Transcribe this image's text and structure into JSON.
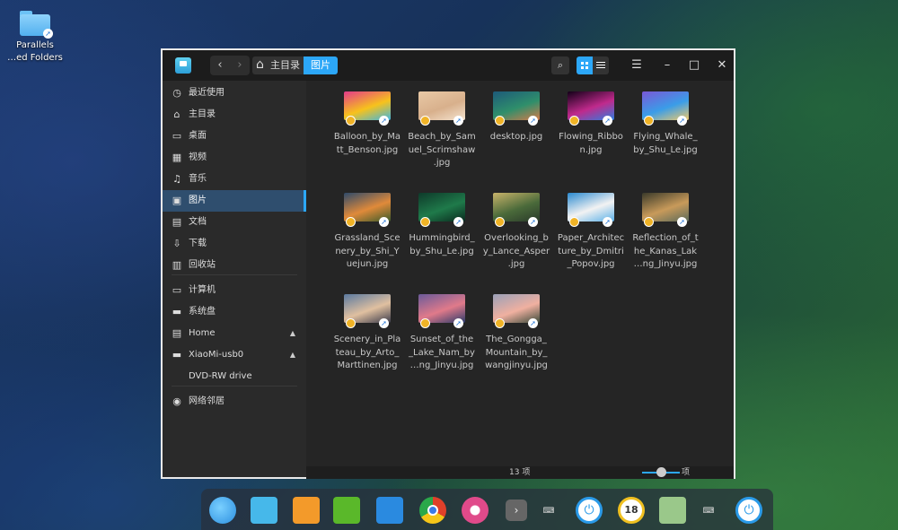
{
  "desktop": {
    "icon_label_line1": "Parallels",
    "icon_label_line2": "…ed Folders"
  },
  "window": {
    "breadcrumb": {
      "home": "主目录",
      "current": "图片"
    },
    "status": {
      "count": "13 项",
      "zoom_label": "项"
    }
  },
  "sidebar": {
    "items": [
      {
        "label": "最近使用",
        "icon": "clock-icon",
        "glyph": "◷"
      },
      {
        "label": "主目录",
        "icon": "home-icon",
        "glyph": "⌂"
      },
      {
        "label": "桌面",
        "icon": "desktop-icon",
        "glyph": "▭"
      },
      {
        "label": "视频",
        "icon": "video-icon",
        "glyph": "▦"
      },
      {
        "label": "音乐",
        "icon": "music-icon",
        "glyph": "♫"
      },
      {
        "label": "图片",
        "icon": "picture-icon",
        "glyph": "▣"
      },
      {
        "label": "文档",
        "icon": "document-icon",
        "glyph": "▤"
      },
      {
        "label": "下载",
        "icon": "download-icon",
        "glyph": "⇩"
      },
      {
        "label": "回收站",
        "icon": "trash-icon",
        "glyph": "▥"
      },
      {
        "label": "计算机",
        "icon": "computer-icon",
        "glyph": "▭"
      },
      {
        "label": "系统盘",
        "icon": "disk-icon",
        "glyph": "▬"
      },
      {
        "label": "Home",
        "icon": "drive-icon",
        "glyph": "▤"
      },
      {
        "label": "XiaoMi-usb0",
        "icon": "usb-icon",
        "glyph": "▬"
      },
      {
        "label": "DVD-RW drive",
        "icon": "",
        "glyph": ""
      },
      {
        "label": "网络邻居",
        "icon": "network-icon",
        "glyph": "◉"
      }
    ]
  },
  "files": [
    {
      "name": "Balloon_by_Matt_Benson.jpg",
      "colors": [
        "#e23a8a",
        "#f7c21c",
        "#3db6e3"
      ]
    },
    {
      "name": "Beach_by_Samuel_Scrimshaw.jpg",
      "colors": [
        "#e9c9a6",
        "#d8b08c",
        "#f4e3cf"
      ]
    },
    {
      "name": "desktop.jpg",
      "colors": [
        "#1d5a7a",
        "#2f8f6b",
        "#d47a4a"
      ]
    },
    {
      "name": "Flowing_Ribbon.jpg",
      "colors": [
        "#120018",
        "#c02a8c",
        "#2d7ee0"
      ]
    },
    {
      "name": "Flying_Whale_by_Shu_Le.jpg",
      "colors": [
        "#7a58d6",
        "#3a9de8",
        "#f0c96a"
      ]
    },
    {
      "name": "Grassland_Scenery_by_Shi_Yuejun.jpg",
      "colors": [
        "#2e4a6a",
        "#e08a3a",
        "#3a5a2a"
      ]
    },
    {
      "name": "Hummingbird_by_Shu_Le.jpg",
      "colors": [
        "#0e3a2a",
        "#1f7a4a",
        "#0a2a1e"
      ]
    },
    {
      "name": "Overlooking_by_Lance_Asper.jpg",
      "colors": [
        "#c8b36a",
        "#4a6a3a",
        "#2a3a2a"
      ]
    },
    {
      "name": "Paper_Architecture_by_Dmitri_Popov.jpg",
      "colors": [
        "#2a8ad0",
        "#f2f2f2",
        "#5ab0e8"
      ]
    },
    {
      "name": "Reflection_of_the_Kanas_Lake_Jinyu.jpg",
      "colors": [
        "#3a3a2a",
        "#c89a5a",
        "#5a6a5a"
      ]
    },
    {
      "name": "Scenery_in_Plateau_by_Arto_Marttinen.jpg",
      "colors": [
        "#5a7aa0",
        "#e0c0a0",
        "#3a3a4a"
      ]
    },
    {
      "name": "Sunset_of_the_Lake_Nam_by…ng_Jinyu.jpg",
      "colors": [
        "#6a5a9a",
        "#e07a8a",
        "#2a3a6a"
      ]
    },
    {
      "name": "The_Gongga_Mountain_by_wangjinyu.jpg",
      "colors": [
        "#9aa0b8",
        "#f0b0a0",
        "#3a4a3a"
      ]
    }
  ],
  "file_display": [
    [
      "Balloon_by_Ma",
      "tt_Benson.jpg"
    ],
    [
      "Beach_by_Sam",
      "uel_Scrimshaw",
      ".jpg"
    ],
    [
      "desktop.jpg"
    ],
    [
      "Flowing_Ribbo",
      "n.jpg"
    ],
    [
      "Flying_Whale_",
      "by_Shu_Le.jpg"
    ],
    [
      "Grassland_Sce",
      "nery_by_Shi_Y",
      "uejun.jpg"
    ],
    [
      "Hummingbird_",
      "by_Shu_Le.jpg"
    ],
    [
      "Overlooking_b",
      "y_Lance_Asper",
      ".jpg"
    ],
    [
      "Paper_Architec",
      "ture_by_Dmitri",
      "_Popov.jpg"
    ],
    [
      "Reflection_of_t",
      "he_Kanas_Lak",
      "…ng_Jinyu.jpg"
    ],
    [
      "Scenery_in_Pla",
      "teau_by_Arto_",
      "Marttinen.jpg"
    ],
    [
      "Sunset_of_the",
      "_Lake_Nam_by",
      "…ng_Jinyu.jpg"
    ],
    [
      "The_Gongga_",
      "Mountain_by_",
      "wangjinyu.jpg"
    ]
  ],
  "dock": {
    "items": [
      {
        "name": "launcher-icon",
        "color": "#2c8fe0"
      },
      {
        "name": "file-manager-icon",
        "color": "#46b8ea"
      },
      {
        "name": "app-store-icon",
        "color": "#f39a2a"
      },
      {
        "name": "music-player-icon",
        "color": "#5ab82a"
      },
      {
        "name": "video-player-icon",
        "color": "#2a8ae0"
      },
      {
        "name": "chrome-icon",
        "color": "#e0402a"
      },
      {
        "name": "settings-icon",
        "color": "#e04a8a"
      },
      {
        "name": "expand-icon",
        "color": "#666666"
      },
      {
        "name": "keyboard-icon",
        "color": ""
      },
      {
        "name": "power-icon",
        "color": "#2a9ae8"
      },
      {
        "name": "clock-icon",
        "color": "#f0c020"
      },
      {
        "name": "trash-icon",
        "color": "#9ac88a"
      },
      {
        "name": "keyboard-icon-2",
        "color": ""
      },
      {
        "name": "shutdown-icon",
        "color": "#2a9ae8"
      }
    ],
    "clock_text": "18"
  }
}
